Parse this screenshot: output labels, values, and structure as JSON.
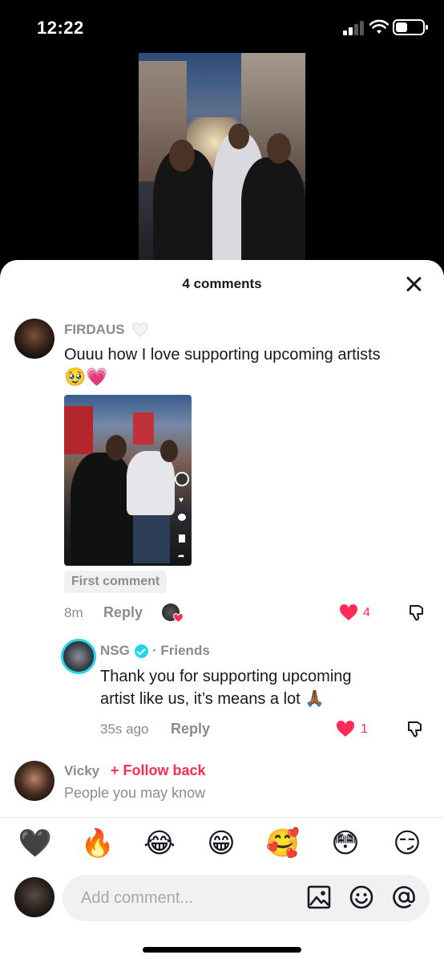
{
  "status_bar": {
    "time": "12:22"
  },
  "sheet": {
    "title": "4 comments",
    "comments": [
      {
        "username": "FIRDAUS",
        "username_icon": "white-heart-icon",
        "text_line1": "Ouuu how I love supporting upcoming artists",
        "emojis": "🥹💗",
        "badge": "First comment",
        "time": "8m",
        "reply_label": "Reply",
        "likes": "4"
      }
    ],
    "reply": {
      "username": "NSG",
      "relation": "· Friends",
      "text_line1": "Thank you for supporting upcoming",
      "text_line2": "artist like us, it’s means a lot 🙏🏾",
      "time": "35s ago",
      "reply_label": "Reply",
      "likes": "1"
    },
    "suggestion": {
      "username": "Vicky",
      "follow_label": "+ Follow back",
      "subtitle": "People you may know"
    }
  },
  "emoji_bar": [
    "🖤",
    "🔥",
    "😂",
    "😁",
    "🥰",
    "😳",
    "😏"
  ],
  "input": {
    "placeholder": "Add comment..."
  },
  "colors": {
    "accent": "#fe2c55",
    "verified": "#20d5ec",
    "muted": "#8a8b91"
  }
}
